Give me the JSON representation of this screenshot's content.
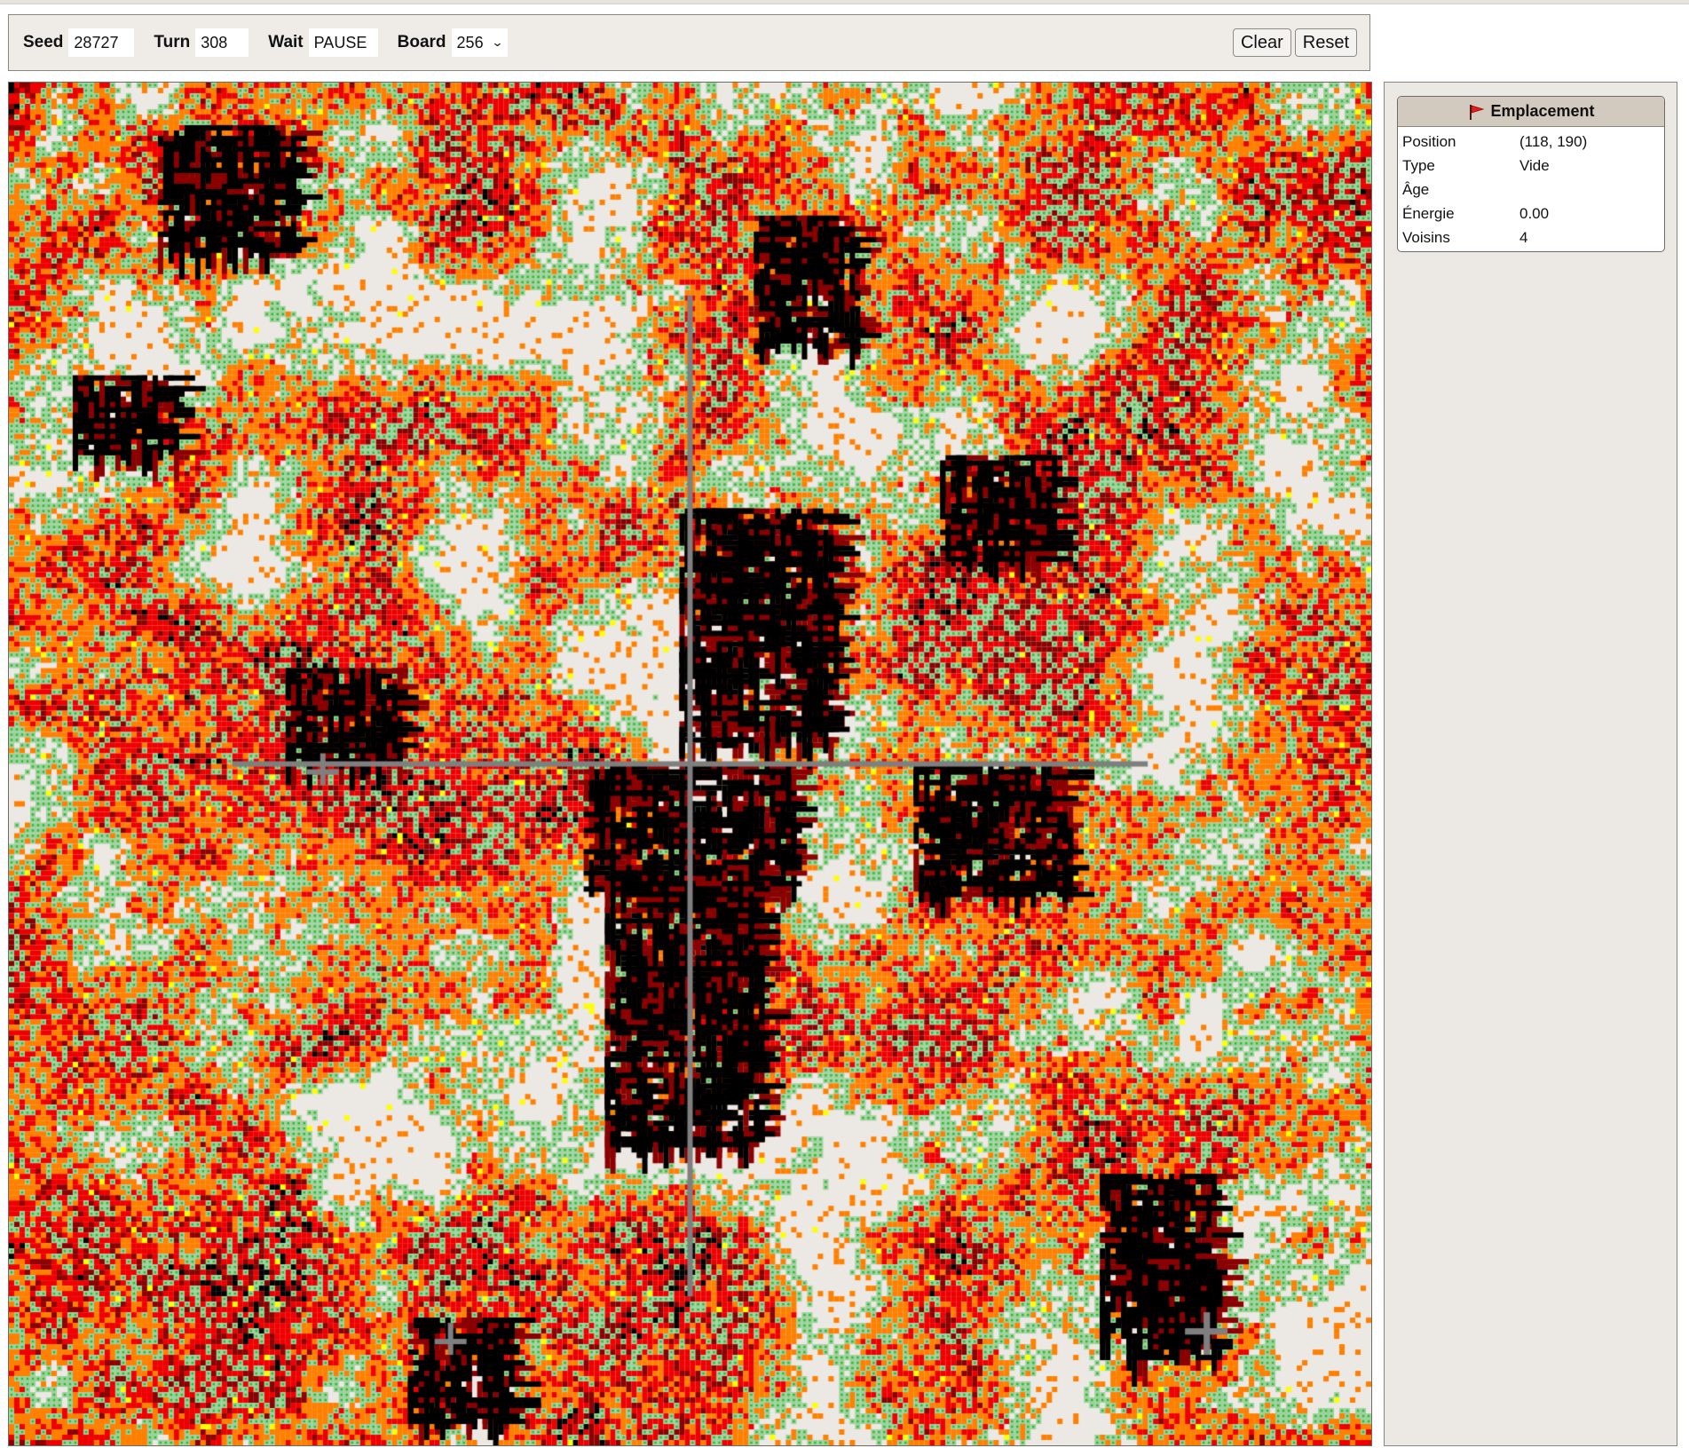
{
  "toolbar": {
    "seed_label": "Seed",
    "seed_value": "28727",
    "turn_label": "Turn",
    "turn_value": "308",
    "wait_label": "Wait",
    "wait_value": "PAUSE",
    "board_label": "Board",
    "board_value": "256",
    "clear_label": "Clear",
    "reset_label": "Reset"
  },
  "board": {
    "grid_size": 256,
    "palette": {
      "empty": "#ece8e3",
      "grass": "#9fd09f",
      "grass_dot": "#20c020",
      "orange": "#ff8000",
      "red": "#ee0000",
      "dark_red": "#8b0000",
      "black": "#000000",
      "yellow": "#ffff00",
      "gray": "#7f7f7f"
    }
  },
  "inspector": {
    "title": "Emplacement",
    "icon": "red-flag-icon",
    "rows": [
      {
        "key": "Position",
        "value": "(118, 190)"
      },
      {
        "key": "Type",
        "value": "Vide"
      },
      {
        "key": "Âge",
        "value": ""
      },
      {
        "key": "Énergie",
        "value": "0.00"
      },
      {
        "key": "Voisins",
        "value": "4"
      }
    ]
  }
}
